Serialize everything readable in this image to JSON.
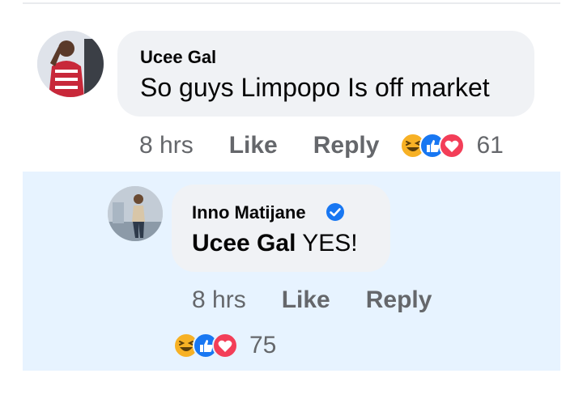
{
  "comment": {
    "author": "Ucee Gal",
    "text": "So guys Limpopo Is off market",
    "time": "8 hrs",
    "like_label": "Like",
    "reply_label": "Reply",
    "reactions": [
      "haha",
      "like",
      "love"
    ],
    "reaction_count": "61"
  },
  "reply": {
    "author": "Inno Matijane",
    "verified": true,
    "mention": "Ucee Gal",
    "text": "YES!",
    "time": "8 hrs",
    "like_label": "Like",
    "reply_label": "Reply",
    "reactions": [
      "haha",
      "like",
      "love"
    ],
    "reaction_count": "75"
  },
  "colors": {
    "highlight": "#e7f3ff",
    "bubble": "#f0f2f5",
    "secondary_text": "#65676b",
    "like_blue": "#1877f2",
    "love_red": "#f33e58",
    "haha_yellow": "#f7b125"
  }
}
